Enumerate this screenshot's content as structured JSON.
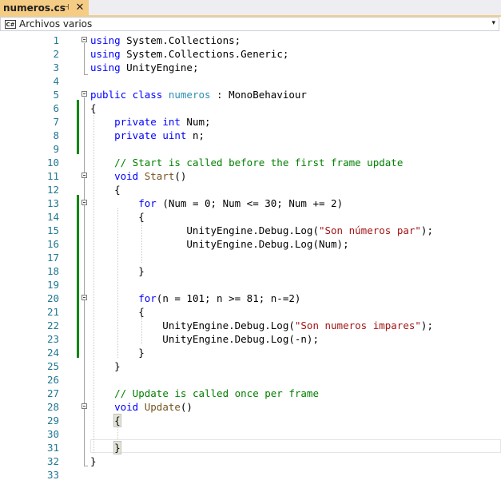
{
  "tab": {
    "title": "numeros.cs",
    "pin_symbol": "⊣",
    "close_symbol": "✕"
  },
  "navbar": {
    "icon_text": "C#",
    "label": "Archivos varios",
    "dropdown_symbol": "▾"
  },
  "colors": {
    "keyword": "#0000ff",
    "type": "#2b91af",
    "string": "#a31515",
    "comment": "#008000",
    "method": "#74531f",
    "line_number": "#237893",
    "change_bar": "#108810",
    "tab_active": "#f5cc84"
  },
  "lines": [
    {
      "n": "1",
      "segs": [
        [
          "kw",
          "using"
        ],
        [
          "",
          "System.Collections;"
        ]
      ]
    },
    {
      "n": "2",
      "segs": [
        [
          "kw",
          "using"
        ],
        [
          "",
          "System.Collections.Generic;"
        ]
      ]
    },
    {
      "n": "3",
      "segs": [
        [
          "kw",
          "using"
        ],
        [
          "",
          "UnityEngine;"
        ]
      ]
    },
    {
      "n": "4",
      "segs": []
    },
    {
      "n": "5",
      "segs": [
        [
          "kw",
          "public class"
        ],
        [
          "ty",
          "numeros"
        ],
        [
          "",
          " : MonoBehaviour"
        ]
      ]
    },
    {
      "n": "6",
      "segs": [
        [
          "",
          "{"
        ]
      ]
    },
    {
      "n": "7",
      "segs": [
        [
          "",
          "    "
        ],
        [
          "kw",
          "private int"
        ],
        [
          "",
          " Num;"
        ]
      ]
    },
    {
      "n": "8",
      "segs": [
        [
          "",
          "    "
        ],
        [
          "kw",
          "private uint"
        ],
        [
          "",
          " n;"
        ]
      ]
    },
    {
      "n": "9",
      "segs": []
    },
    {
      "n": "10",
      "segs": [
        [
          "",
          "    "
        ],
        [
          "cm",
          "// Start is called before the first frame update"
        ]
      ]
    },
    {
      "n": "11",
      "segs": [
        [
          "",
          "    "
        ],
        [
          "kw",
          "void"
        ],
        [
          "fn",
          " Start"
        ],
        [
          "",
          "()"
        ]
      ]
    },
    {
      "n": "12",
      "segs": [
        [
          "",
          "    {"
        ]
      ]
    },
    {
      "n": "13",
      "segs": [
        [
          "",
          "        "
        ],
        [
          "kw",
          "for"
        ],
        [
          "",
          " (Num = 0; Num <= 30; Num += 2)"
        ]
      ]
    },
    {
      "n": "14",
      "segs": [
        [
          "",
          "        {"
        ]
      ]
    },
    {
      "n": "15",
      "segs": [
        [
          "",
          "                UnityEngine.Debug.Log("
        ],
        [
          "str",
          "\"Son números par\""
        ],
        [
          "",
          ");"
        ]
      ]
    },
    {
      "n": "16",
      "segs": [
        [
          "",
          "                UnityEngine.Debug.Log(Num);"
        ]
      ]
    },
    {
      "n": "17",
      "segs": []
    },
    {
      "n": "18",
      "segs": [
        [
          "",
          "        }"
        ]
      ]
    },
    {
      "n": "19",
      "segs": []
    },
    {
      "n": "20",
      "segs": [
        [
          "",
          "        "
        ],
        [
          "kw",
          "for"
        ],
        [
          "",
          "(n = 101; n >= 81; n-=2)"
        ]
      ]
    },
    {
      "n": "21",
      "segs": [
        [
          "",
          "        {"
        ]
      ]
    },
    {
      "n": "22",
      "segs": [
        [
          "",
          "            UnityEngine.Debug.Log("
        ],
        [
          "str",
          "\"Son numeros impares\""
        ],
        [
          "",
          ");"
        ]
      ]
    },
    {
      "n": "23",
      "segs": [
        [
          "",
          "            UnityEngine.Debug.Log(-n);"
        ]
      ]
    },
    {
      "n": "24",
      "segs": [
        [
          "",
          "        }"
        ]
      ]
    },
    {
      "n": "25",
      "segs": [
        [
          "",
          "    }"
        ]
      ]
    },
    {
      "n": "26",
      "segs": []
    },
    {
      "n": "27",
      "segs": [
        [
          "",
          "    "
        ],
        [
          "cm",
          "// Update is called once per frame"
        ]
      ]
    },
    {
      "n": "28",
      "segs": [
        [
          "",
          "    "
        ],
        [
          "kw",
          "void"
        ],
        [
          "fn",
          " Update"
        ],
        [
          "",
          "()"
        ]
      ]
    },
    {
      "n": "29",
      "segs": [
        [
          "",
          "    "
        ],
        [
          "hl",
          "{"
        ]
      ]
    },
    {
      "n": "30",
      "segs": []
    },
    {
      "n": "31",
      "segs": [
        [
          "",
          "    "
        ],
        [
          "hl",
          "}"
        ]
      ]
    },
    {
      "n": "32",
      "segs": [
        [
          "",
          "}"
        ]
      ]
    },
    {
      "n": "33",
      "segs": []
    }
  ]
}
